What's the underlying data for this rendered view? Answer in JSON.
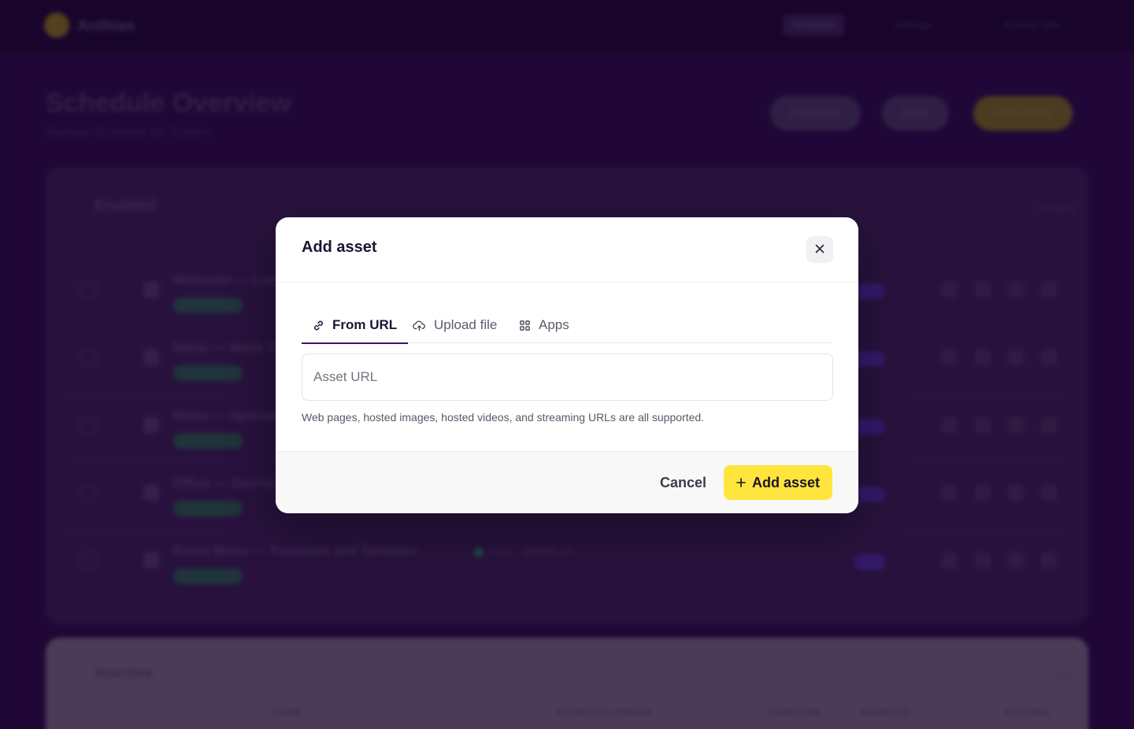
{
  "background": {
    "brand": "Anthias",
    "nav": [
      {
        "label": "Schedule"
      },
      {
        "label": "Settings"
      },
      {
        "label": "System Info"
      }
    ],
    "page_title": "Schedule Overview",
    "page_subtitle": "Manage Schedule for Screen",
    "header_buttons": [
      {
        "label": "Previous"
      },
      {
        "label": "Next"
      },
      {
        "label": "Add Asset"
      }
    ],
    "active_panel": {
      "title": "Enabled",
      "link": "Collapse",
      "rows": [
        {
          "name": "Welcome — Lobby Screen"
        },
        {
          "name": "Menu — Week Overview"
        },
        {
          "name": "Menu — Specials"
        },
        {
          "name": "Office — Dashboard"
        },
        {
          "name": "Event Menu — Tuesdays and Sundays",
          "schedule": "Live · always on"
        }
      ]
    },
    "inactive_panel": {
      "title": "Inactive",
      "link": "Expand",
      "columns": [
        "NAME",
        "SCHEDULE PERIOD",
        "DURATION",
        "ENABLED",
        "ACTIONS"
      ]
    }
  },
  "modal": {
    "title": "Add asset",
    "close_icon": "close-icon",
    "tabs": [
      {
        "label": "From URL",
        "icon": "link-icon",
        "active": true
      },
      {
        "label": "Upload file",
        "icon": "cloud-upload-icon",
        "active": false
      },
      {
        "label": "Apps",
        "icon": "apps-grid-icon",
        "active": false
      }
    ],
    "url_input": {
      "placeholder": "Asset URL",
      "value": ""
    },
    "helper_text": "Web pages, hosted images, hosted videos, and streaming URLs are all supported.",
    "cancel_label": "Cancel",
    "submit_label": "Add asset",
    "accent_color": "#ffe53d"
  }
}
